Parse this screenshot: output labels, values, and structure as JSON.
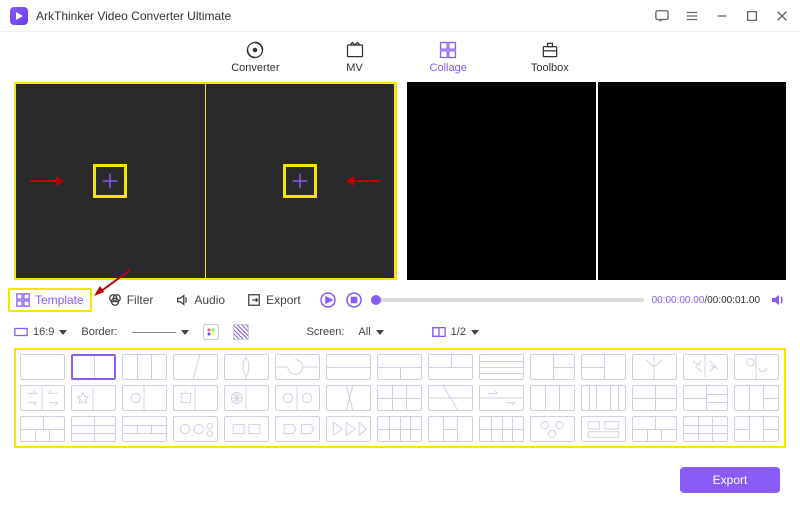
{
  "app": {
    "title": "ArkThinker Video Converter Ultimate"
  },
  "mainTabs": {
    "converter": "Converter",
    "mv": "MV",
    "collage": "Collage",
    "toolbox": "Toolbox",
    "active": "collage"
  },
  "subTabs": {
    "template": "Template",
    "filter": "Filter",
    "audio": "Audio",
    "export": "Export",
    "active": "template"
  },
  "player": {
    "time_current": "00:00:00.00",
    "time_total": "00:00:01.00"
  },
  "options": {
    "ratio_label": "16:9",
    "border_label": "Border:",
    "screen_label": "Screen:",
    "screen_value": "All",
    "page_value": "1/2"
  },
  "footer": {
    "export_label": "Export"
  },
  "colors": {
    "accent": "#8a5cf6",
    "highlight": "#f5e600"
  }
}
